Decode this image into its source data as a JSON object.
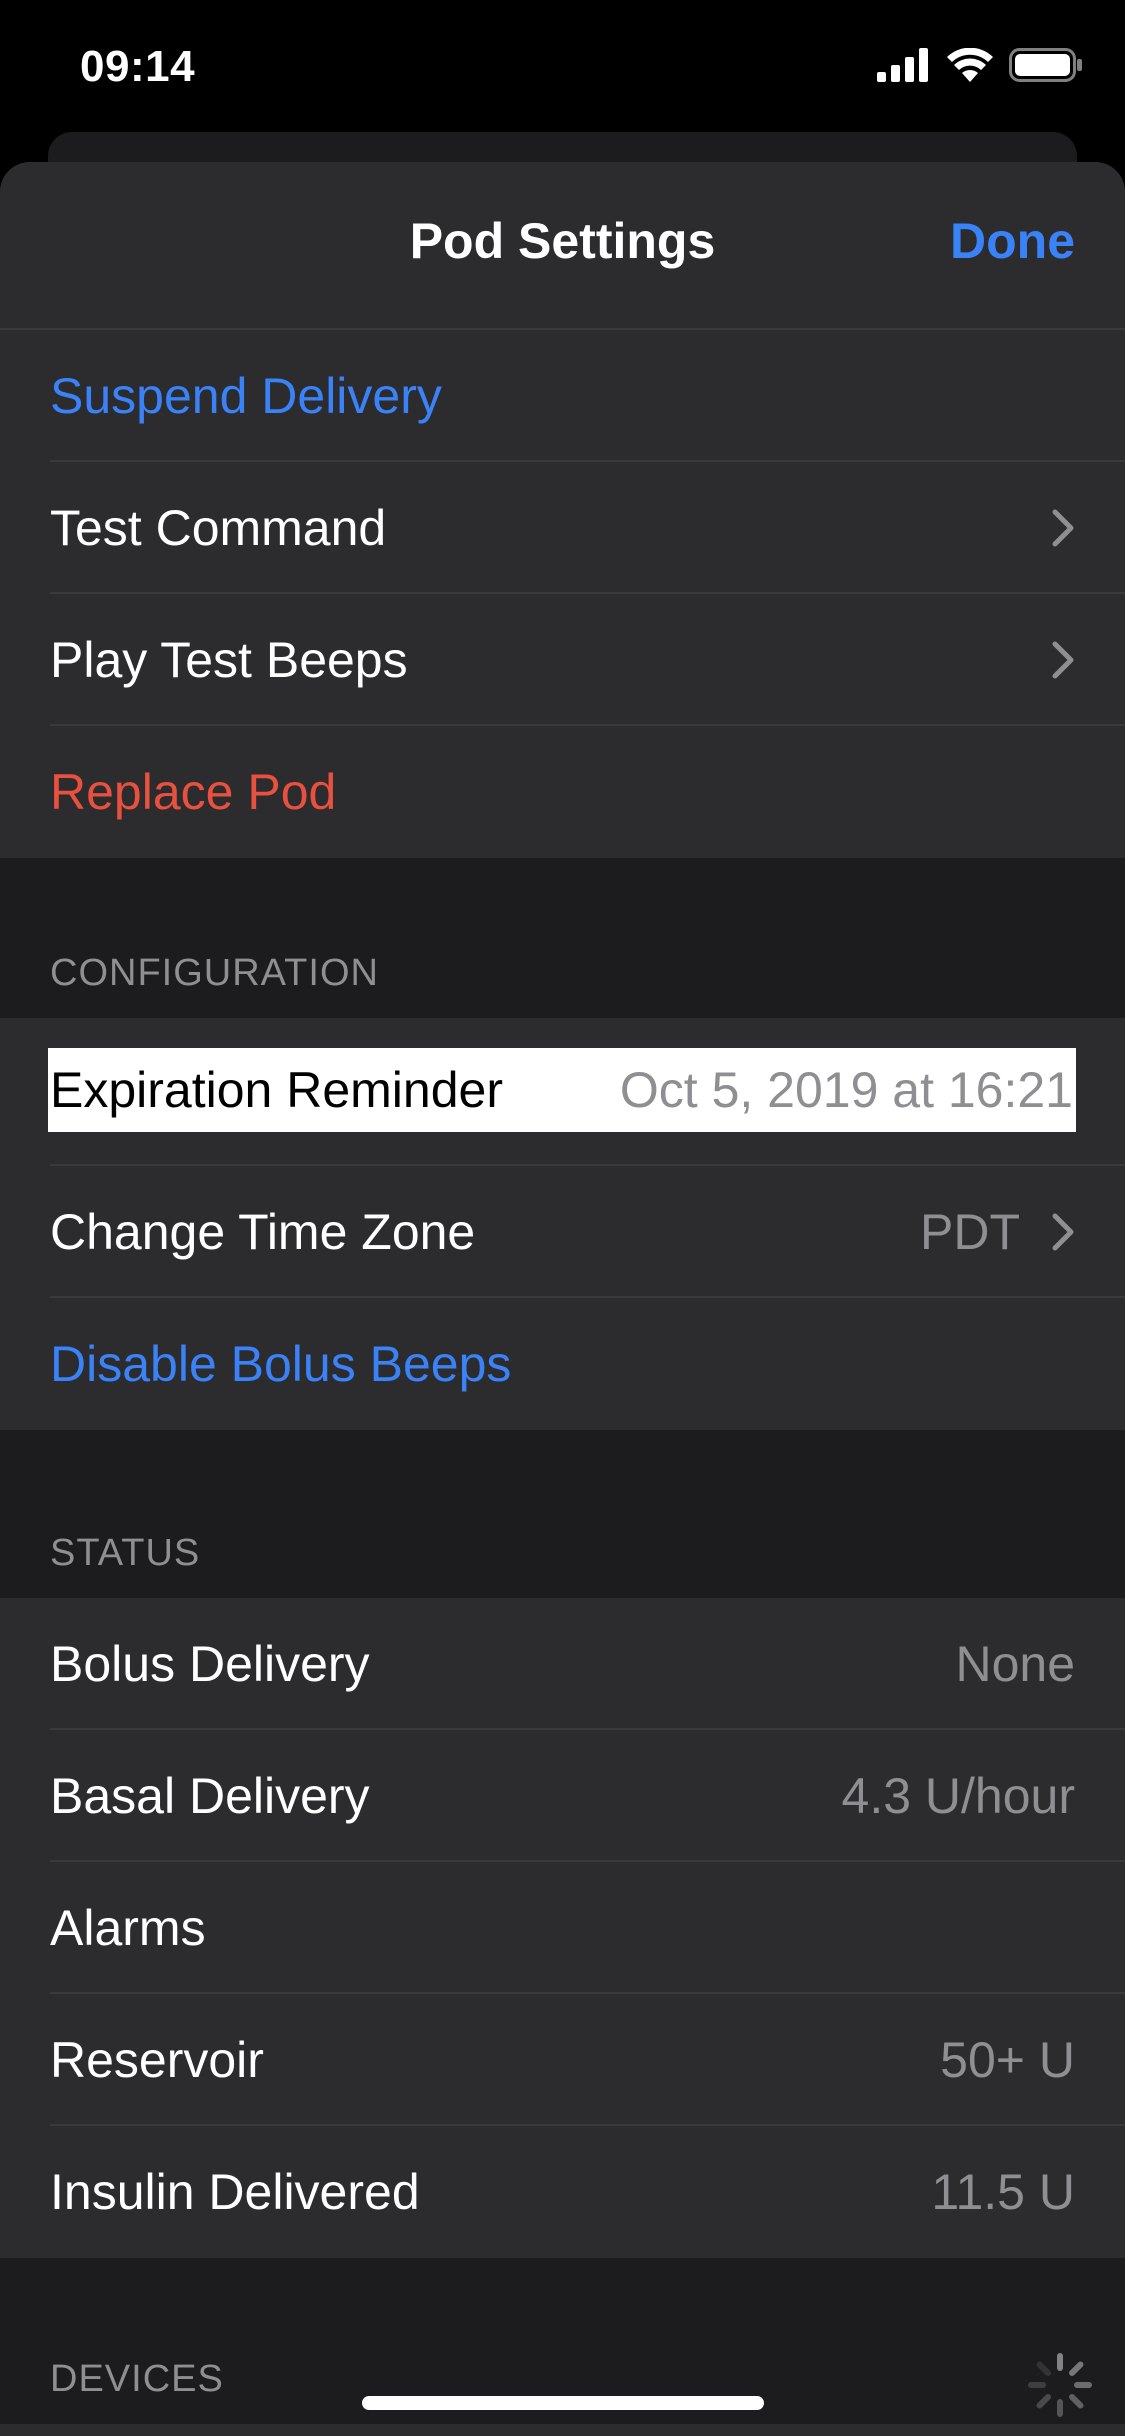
{
  "status_bar": {
    "time": "09:14",
    "icons": [
      "cellular-signal-icon",
      "wifi-icon",
      "battery-icon"
    ]
  },
  "nav": {
    "title": "Pod Settings",
    "done_label": "Done"
  },
  "actions": [
    {
      "label": "Suspend Delivery",
      "style": "blue"
    },
    {
      "label": "Test Command",
      "chevron": true
    },
    {
      "label": "Play Test Beeps",
      "chevron": true
    },
    {
      "label": "Replace Pod",
      "style": "red"
    }
  ],
  "configuration": {
    "header": "CONFIGURATION",
    "expiration_reminder": {
      "label": "Expiration Reminder",
      "value": "Oct 5, 2019 at 16:21"
    },
    "change_time_zone": {
      "label": "Change Time Zone",
      "value": "PDT"
    },
    "disable_bolus_beeps": {
      "label": "Disable Bolus Beeps"
    }
  },
  "status": {
    "header": "STATUS",
    "rows": [
      {
        "label": "Bolus Delivery",
        "value": "None"
      },
      {
        "label": "Basal Delivery",
        "value": "4.3 U/hour"
      },
      {
        "label": "Alarms",
        "value": ""
      },
      {
        "label": "Reservoir",
        "value": "50+ U"
      },
      {
        "label": "Insulin Delivered",
        "value": "11.5 U"
      }
    ]
  },
  "devices": {
    "header": "DEVICES"
  },
  "colors": {
    "accent": "#3a82f7",
    "destructive": "#e8503f",
    "background": "#1c1c1e",
    "cell": "#2c2c2e",
    "secondary_text": "#8e8e93"
  }
}
